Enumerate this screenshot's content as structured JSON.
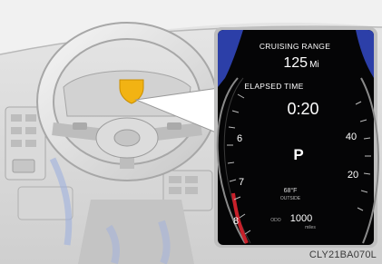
{
  "display": {
    "cruising_range_label": "CRUISING RANGE",
    "cruising_range_value": "125",
    "cruising_range_unit": "Mi",
    "elapsed_time_label": "ELAPSED TIME",
    "elapsed_time_value": "0:20",
    "gear": "P",
    "outside_temp_value": "68°F",
    "outside_temp_label": "OUTSIDE",
    "odometer_prefix": "ODO",
    "odometer_value": "1000",
    "odometer_unit": "miles"
  },
  "tachometer_ticks": [
    "6",
    "7",
    "8"
  ],
  "speedometer_ticks": [
    "40",
    "20"
  ],
  "figure_code": "CLY21BA070L",
  "colors": {
    "highlight_marker": "#f2b313",
    "display_accent": "#2c3fa8",
    "redline": "#c8202a"
  }
}
